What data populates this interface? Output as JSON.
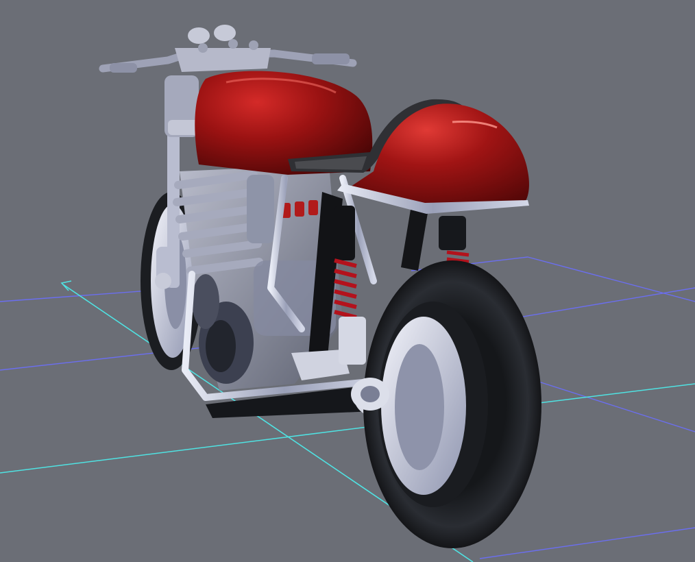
{
  "viewport": {
    "background": "#6b6e76",
    "grid_color": "#6b6ef0",
    "axis_color": "#4fe3e3",
    "axis_arrow_icon": "arrow-icon"
  },
  "model": {
    "name": "",
    "bodywork_color": "#8c0f10",
    "frame_color": "#c9ccdc",
    "tire_color": "#1e2024",
    "spring_color": "#b3121c",
    "seat_color": "#3a3a3a"
  }
}
